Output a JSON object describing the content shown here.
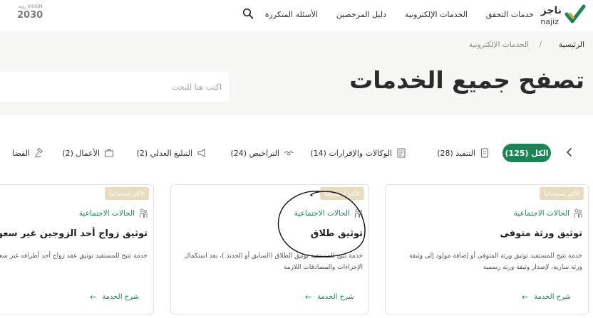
{
  "header": {
    "logo": {
      "arabic": "ناجز",
      "latin": "najiz"
    },
    "nav": [
      {
        "label": "خدمات التحقق"
      },
      {
        "label": "الخدمات الإلكترونية"
      },
      {
        "label": "دليل المرخصين"
      },
      {
        "label": "الأسئلة المتكررة"
      }
    ],
    "search_icon": "search-icon",
    "vision": {
      "top": "رؤية VISION",
      "year": "2030"
    }
  },
  "breadcrumb": {
    "home": "الرئيسية",
    "separator": "/",
    "current": "الخدمات الإلكترونية"
  },
  "page_title": "تصفح جميع الخدمات",
  "search": {
    "placeholder": "اكتب هنا للبحث",
    "value": ""
  },
  "tabs": [
    {
      "label": "الكل (125)",
      "active": true
    },
    {
      "label": "التنفيذ (28)",
      "icon": "document-icon"
    },
    {
      "label": "الوكالات والإقرارات (14)",
      "icon": "file-list-icon"
    },
    {
      "label": "التراخيص (24)",
      "icon": "handshake-icon"
    },
    {
      "label": "التبليغ العدلي (2)",
      "icon": "megaphone-icon"
    },
    {
      "label": "الأعمال (2)",
      "icon": "briefcase-icon"
    },
    {
      "label": "القضا",
      "icon": "gavel-icon"
    }
  ],
  "cards": [
    {
      "badge": "الأكثر استخداماً",
      "category": "الحالات الاجتماعية",
      "title": "توثيق ورثة متوفى",
      "desc": [
        "خدمة تتيح للمستفيد توثيق ورثة المتوفى أو إضافة مولود إلى وثيقة",
        "ورثة سارية، لإصدار وثيقة ورثة رسمية"
      ],
      "link": "شرح الخدمة"
    },
    {
      "badge": "الأكثر استخداماً",
      "category": "الحالات الاجتماعية",
      "title": "توثيق طلاق",
      "desc": [
        "خدمة تتيح للمستفيد توثيق الطلاق (السابق أو الجديد )، بعد استكمال",
        "الإجراءات والمصادقات اللازمة"
      ],
      "link": "شرح الخدمة"
    },
    {
      "badge": "الأكثر استخداماً",
      "category": "الحالات الاجتماعية",
      "title": "توثيق زواج أحد الزوجين غير سعودي",
      "desc": [
        "خدمة تتيح للمستفيد توثيق عقد زواج أحد أطرافه غير سعودي",
        ""
      ],
      "link": "شرح الخدمة"
    }
  ],
  "colors": {
    "brand": "#1b8354",
    "badge": "#e8dcbf",
    "background": "#f7f7f5"
  }
}
